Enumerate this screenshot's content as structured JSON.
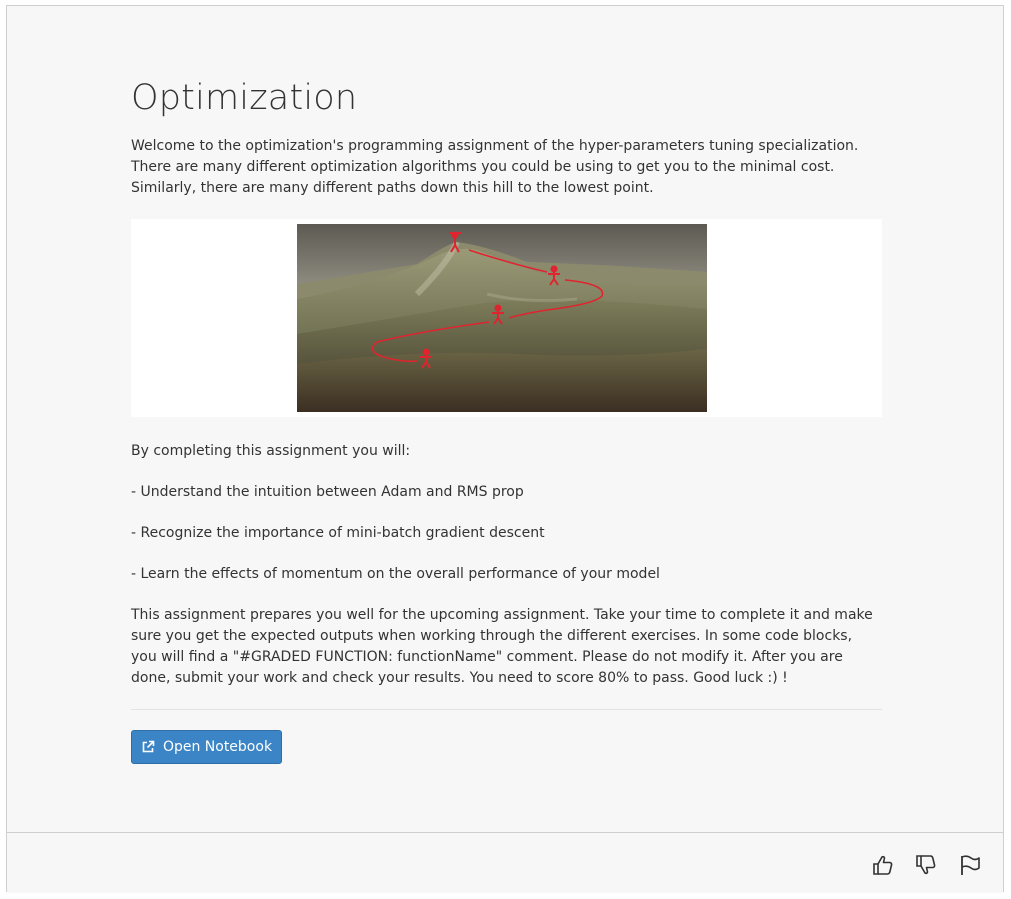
{
  "page": {
    "title": "Optimization",
    "intro": "Welcome to the optimization's programming assignment of the hyper-parameters tuning specialization. There are many different optimization algorithms you could be using to get you to the minimal cost. Similarly, there are many different paths down this hill to the lowest point.",
    "objectives_heading": "By completing this assignment you will:",
    "objectives": [
      "- Understand the intuition between Adam and RMS prop",
      "- Recognize the importance of mini-batch gradient descent",
      "- Learn the effects of momentum on the overall performance of your model"
    ],
    "closing": "This assignment prepares you well for the upcoming assignment. Take your time to complete it and make sure you get the expected outputs when working through the different exercises. In some code blocks, you will find a \"#GRADED FUNCTION: functionName\" comment. Please do not modify it. After you are done, submit your work and check your results. You need to score 80% to pass. Good luck :) !"
  },
  "actions": {
    "open_notebook_label": "Open Notebook",
    "open_notebook_icon": "external-link-icon"
  },
  "footer": {
    "icons": [
      "thumbs-up-icon",
      "thumbs-down-icon",
      "flag-icon"
    ]
  },
  "colors": {
    "accent": "#3b85c6",
    "path_red": "#e0242f"
  }
}
